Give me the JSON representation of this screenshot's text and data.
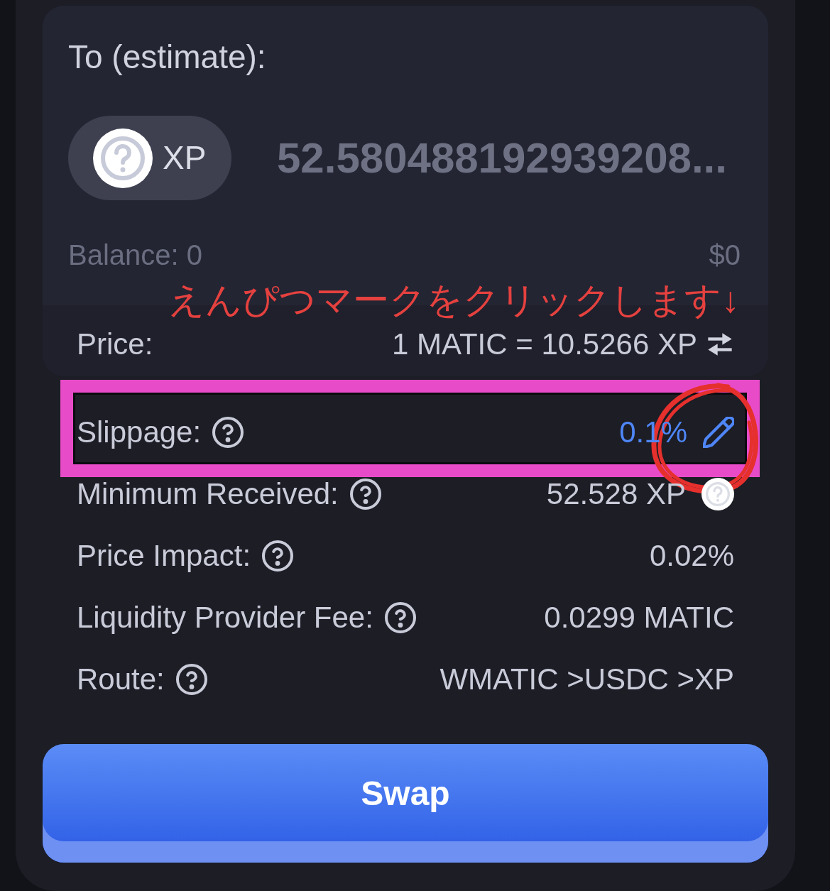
{
  "to_card": {
    "label": "To (estimate):",
    "token": {
      "symbol": "XP"
    },
    "amount": "52.580488192939208...",
    "balance": "Balance: 0",
    "balance_value": "$0",
    "price": {
      "label": "Price:",
      "value": "1 MATIC = 10.5266 XP"
    }
  },
  "details": [
    {
      "kind": "editable",
      "label": "Slippage:",
      "value": "0.1%",
      "highlighted": true,
      "circled": true
    },
    {
      "kind": "token_amount",
      "label": "Minimum Received:",
      "value": "52.528 XP",
      "highlighted": false,
      "circled": false
    },
    {
      "kind": "plain",
      "label": "Price Impact:",
      "value": "0.02%",
      "highlighted": false,
      "circled": false
    },
    {
      "kind": "plain",
      "label": "Liquidity Provider Fee:",
      "value": "0.0299 MATIC",
      "highlighted": false,
      "circled": false
    },
    {
      "kind": "plain",
      "label": "Route:",
      "value": "WMATIC >USDC >XP",
      "highlighted": false,
      "circled": false
    }
  ],
  "swap_button": {
    "label": "Swap"
  },
  "annotation": {
    "text": "えんぴつマークをクリックします↓"
  }
}
